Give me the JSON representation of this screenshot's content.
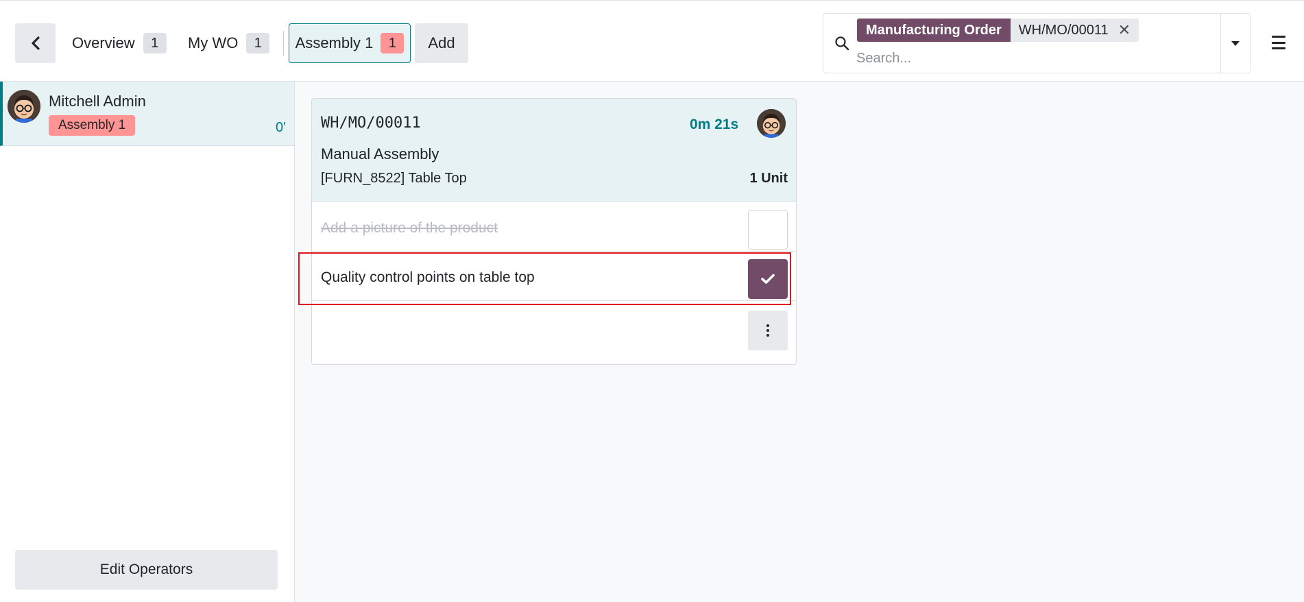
{
  "topbar": {
    "tabs": [
      {
        "label": "Overview",
        "count": "1"
      },
      {
        "label": "My WO",
        "count": "1"
      },
      {
        "label": "Assembly 1",
        "count": "1",
        "active": true
      }
    ],
    "add_label": "Add"
  },
  "search": {
    "facet_label": "Manufacturing Order",
    "facet_value": "WH/MO/00011",
    "facet_close": "✕",
    "placeholder": "Search..."
  },
  "sidebar": {
    "operator": {
      "name": "Mitchell Admin",
      "workcenter": "Assembly 1",
      "time": "0'"
    },
    "edit_operators_label": "Edit Operators"
  },
  "workorder": {
    "reference": "WH/MO/00011",
    "timer": "0m 21s",
    "operation": "Manual Assembly",
    "product": "[FURN_8522] Table Top",
    "quantity": "1 Unit",
    "steps": [
      {
        "label": "Add a picture of the product",
        "done": true
      },
      {
        "label": "Quality control points on table top",
        "done": false,
        "highlighted": true
      }
    ]
  },
  "colors": {
    "brand": "#714b67",
    "teal": "#017e84",
    "badge_red": "#ff9494",
    "highlight_red": "#e0141e"
  },
  "icons": [
    "chevron-left-icon",
    "search-icon",
    "close-icon",
    "caret-down-icon",
    "hamburger-menu-icon",
    "checkmark-icon",
    "kebab-vertical-icon"
  ]
}
